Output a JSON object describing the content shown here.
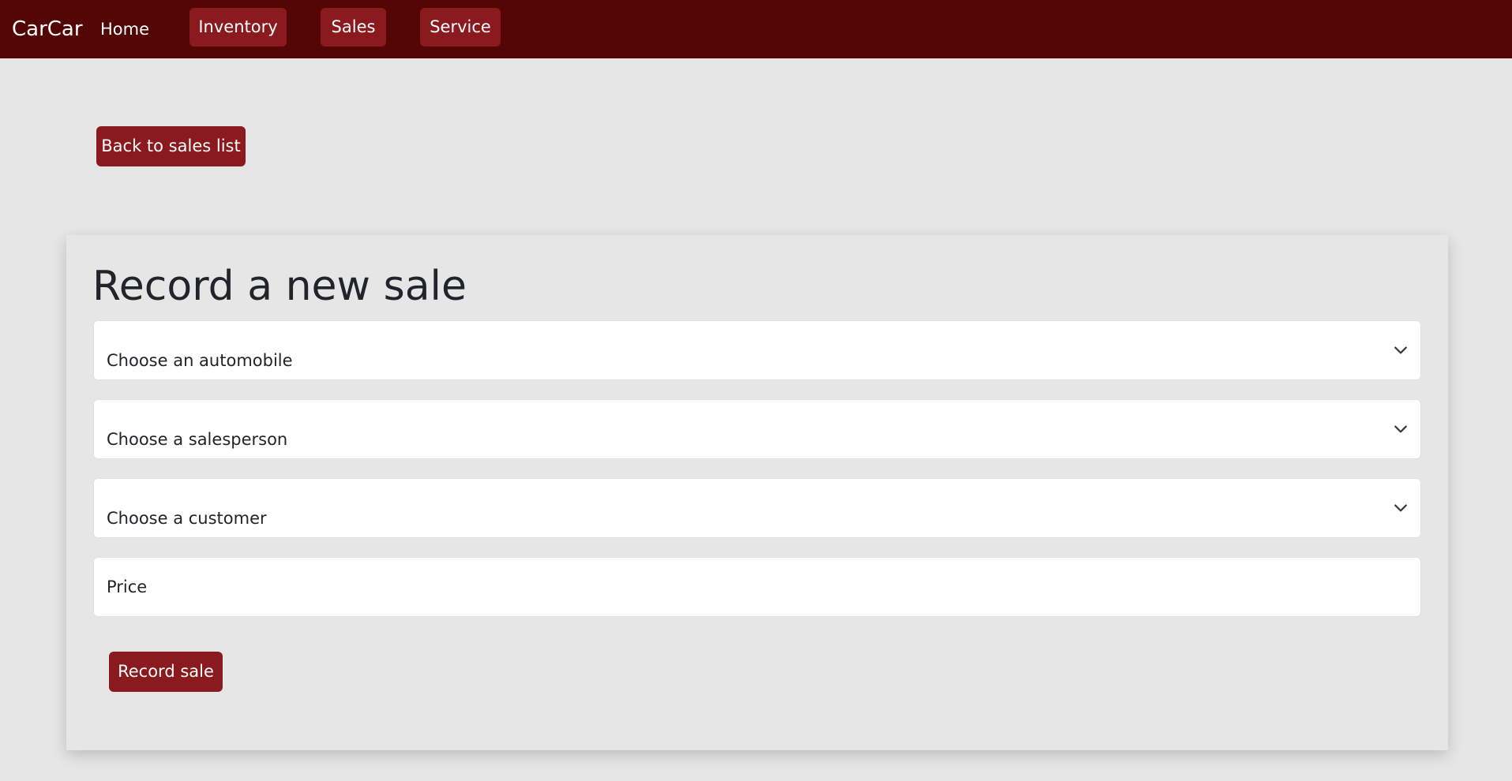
{
  "navbar": {
    "brand": "CarCar",
    "home": "Home",
    "inventory": "Inventory",
    "sales": "Sales",
    "service": "Service",
    "background_color": "#540606",
    "button_color": "#8b1a1f"
  },
  "page": {
    "back_button": "Back to sales list",
    "title": "Record a new sale",
    "automobile_select": {
      "selected": "Choose an automobile",
      "icon": "chevron-down-icon"
    },
    "salesperson_select": {
      "selected": "Choose a salesperson",
      "icon": "chevron-down-icon"
    },
    "customer_select": {
      "selected": "Choose a customer",
      "icon": "chevron-down-icon"
    },
    "price_field": {
      "placeholder": "Price"
    },
    "submit_button": "Record sale",
    "background_color": "#e6e6e6"
  }
}
